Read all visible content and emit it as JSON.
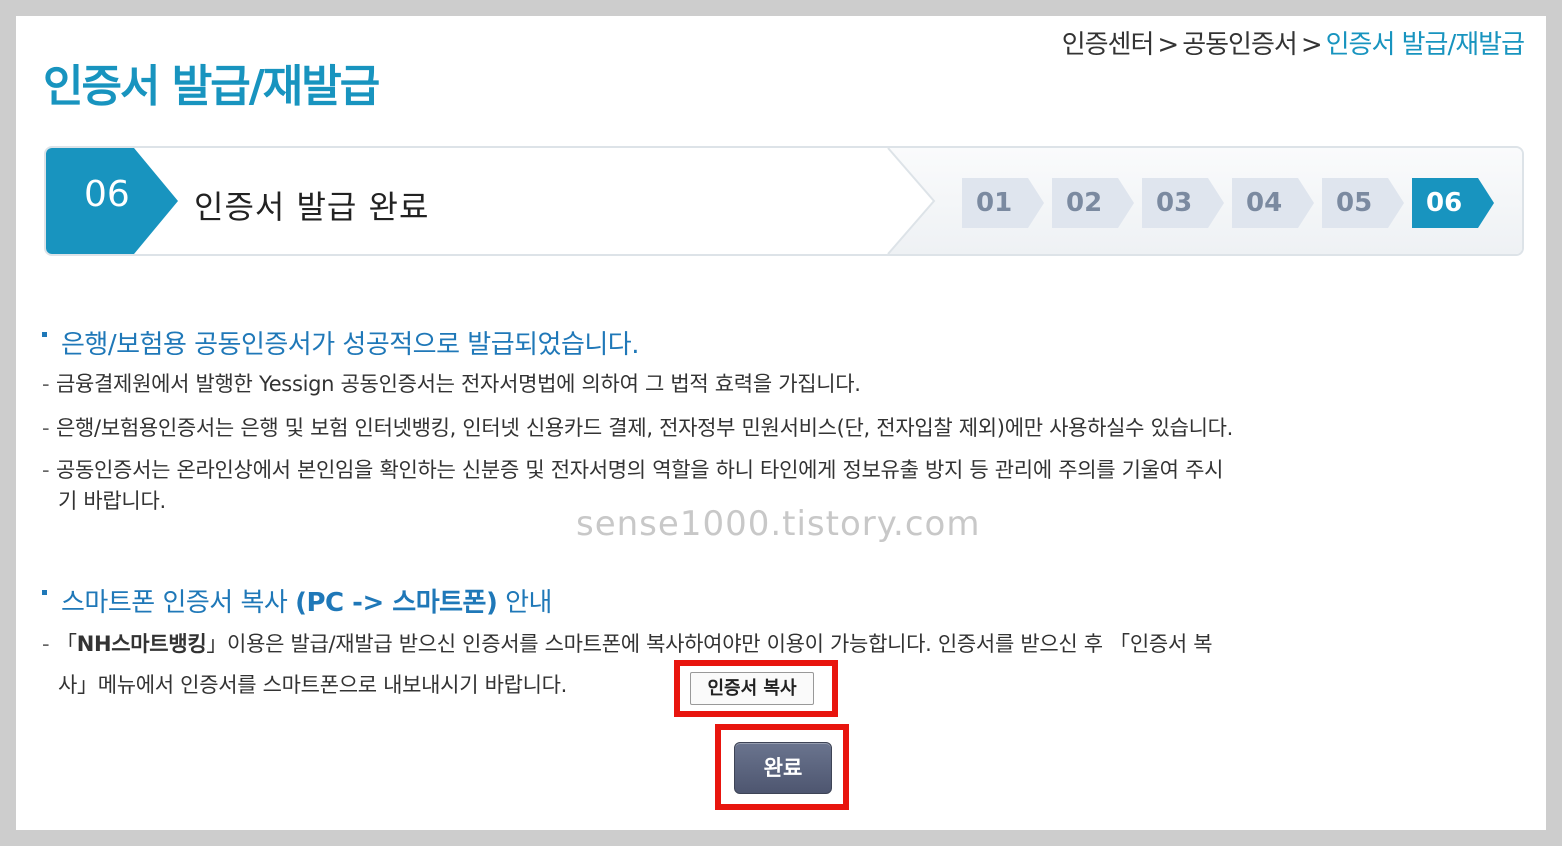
{
  "page": {
    "title": "인증서 발급/재발급"
  },
  "breadcrumb": {
    "items": [
      "인증센터",
      "공동인증서",
      "인증서 발급/재발급"
    ],
    "separator": ">"
  },
  "step": {
    "number": "06",
    "title": "인증서 발급 완료",
    "chips": [
      "01",
      "02",
      "03",
      "04",
      "05",
      "06"
    ],
    "active_chip": "06"
  },
  "notice": {
    "heading_prefix": "은행/보험용 공동인증서가 성공적으로 발급되었습니다.",
    "lines": [
      "금융결제원에서 발행한 Yessign 공동인증서는 전자서명법에 의하여 그 법적 효력을 가집니다.",
      "은행/보험용인증서는 은행 및 보험 인터넷뱅킹, 인터넷 신용카드 결제, 전자정부 민원서비스(단, 전자입찰 제외)에만 사용하실수 있습니다.",
      "공동인증서는 온라인상에서 본인임을 확인하는 신분증 및 전자서명의 역할을 하니 타인에게 정보유출 방지 등 관리에 주의를 기울여 주시",
      "기 바랍니다."
    ]
  },
  "smartphone": {
    "heading_a": "스마트폰 인증서 복사 ",
    "heading_b": "(PC -> 스마트폰)",
    "heading_c": " 안내",
    "line1_open": "「",
    "line1_bold": "NH스마트뱅킹",
    "line1_rest": "」이용은 발급/재발급 받으신 인증서를 스마트폰에 복사하여야만 이용이 가능합니다. 인증서를 받으신 후 「인증서 복",
    "line2": "사」메뉴에서 인증서를 스마트폰으로 내보내시기 바랍니다.",
    "copy_button": "인증서 복사"
  },
  "watermark": "sense1000.tistory.com",
  "done_button": "완료",
  "colors": {
    "accent": "#1894bf",
    "heading_blue": "#1f78b8",
    "highlight_red": "#e8150e",
    "chip_inactive": "#dfe5ee",
    "done_button": "#5d6580"
  }
}
